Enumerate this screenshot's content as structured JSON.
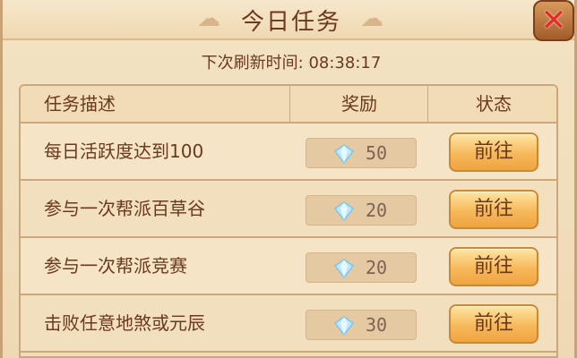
{
  "dialog": {
    "title": "今日任务",
    "refresh_label": "下次刷新时间: 08:38:17"
  },
  "table": {
    "headers": {
      "desc": "任务描述",
      "reward": "奖励",
      "status": "状态"
    },
    "rows": [
      {
        "desc": "每日活跃度达到100",
        "reward": "50",
        "action": "前往"
      },
      {
        "desc": "参与一次帮派百草谷",
        "reward": "20",
        "action": "前往"
      },
      {
        "desc": "参与一次帮派竞赛",
        "reward": "20",
        "action": "前往"
      },
      {
        "desc": "击败任意地煞或元辰",
        "reward": "30",
        "action": "前往"
      }
    ]
  },
  "colors": {
    "accent_button": "#f6b85a",
    "close_x": "#e82a24",
    "text": "#6b3a1c"
  },
  "icons": {
    "reward": "gem-icon",
    "close": "close-icon"
  }
}
